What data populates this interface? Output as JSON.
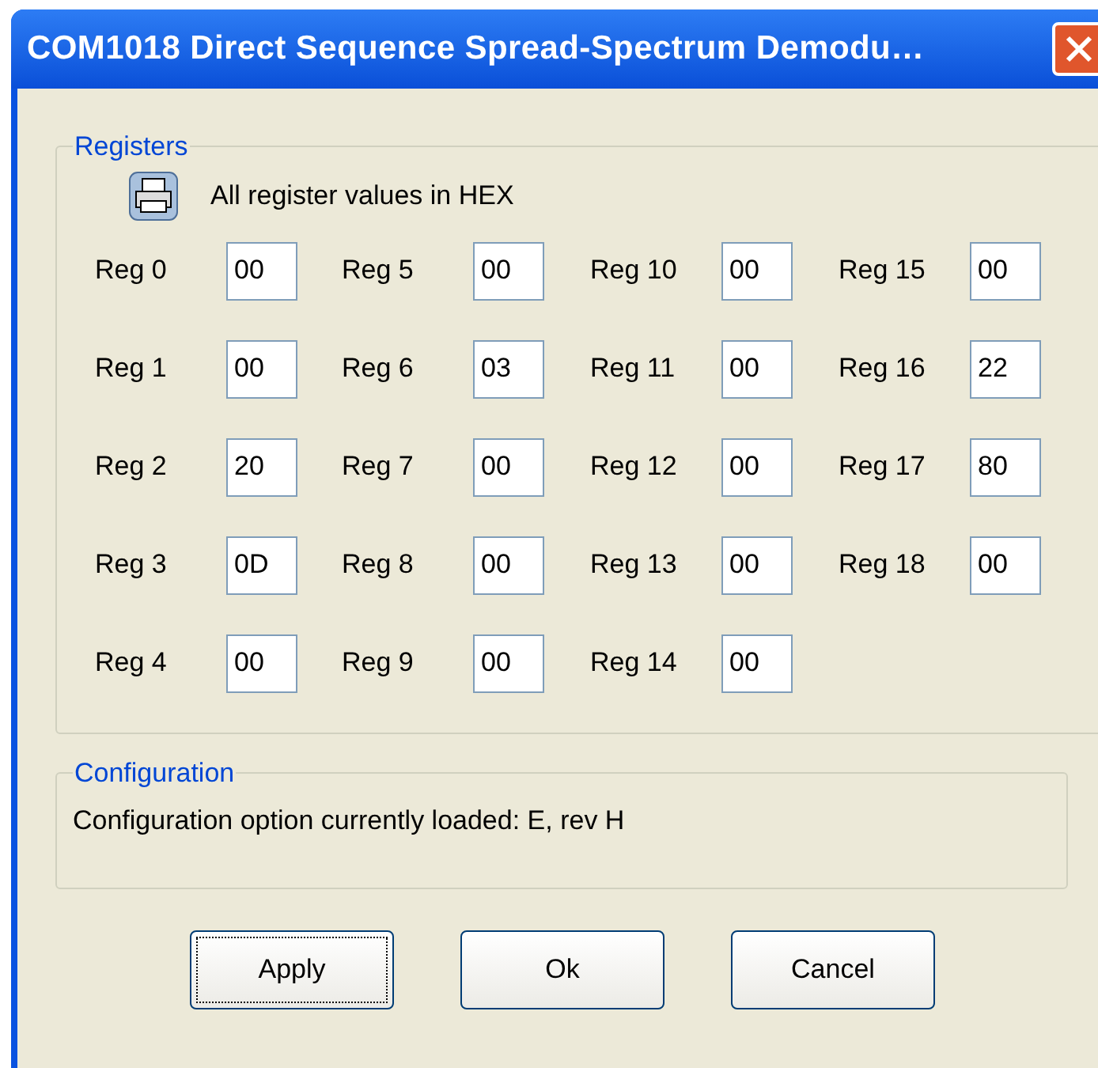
{
  "window": {
    "title": "COM1018 Direct Sequence Spread-Spectrum Demodu…"
  },
  "registers": {
    "legend": "Registers",
    "note": "All register values in HEX",
    "items": [
      {
        "label": "Reg 0",
        "value": "00"
      },
      {
        "label": "Reg 1",
        "value": "00"
      },
      {
        "label": "Reg 2",
        "value": "20"
      },
      {
        "label": "Reg 3",
        "value": "0D"
      },
      {
        "label": "Reg 4",
        "value": "00"
      },
      {
        "label": "Reg 5",
        "value": "00"
      },
      {
        "label": "Reg 6",
        "value": "03"
      },
      {
        "label": "Reg 7",
        "value": "00"
      },
      {
        "label": "Reg 8",
        "value": "00"
      },
      {
        "label": "Reg 9",
        "value": "00"
      },
      {
        "label": "Reg 10",
        "value": "00"
      },
      {
        "label": "Reg 11",
        "value": "00"
      },
      {
        "label": "Reg 12",
        "value": "00"
      },
      {
        "label": "Reg 13",
        "value": "00"
      },
      {
        "label": "Reg 14",
        "value": "00"
      },
      {
        "label": "Reg 15",
        "value": "00"
      },
      {
        "label": "Reg 16",
        "value": "22"
      },
      {
        "label": "Reg 17",
        "value": "80"
      },
      {
        "label": "Reg 18",
        "value": "00"
      }
    ]
  },
  "configuration": {
    "legend": "Configuration",
    "text": "Configuration option currently loaded: E, rev H"
  },
  "buttons": [
    {
      "label": "Apply",
      "focused": true
    },
    {
      "label": "Ok",
      "focused": false
    },
    {
      "label": "Cancel",
      "focused": false
    }
  ]
}
